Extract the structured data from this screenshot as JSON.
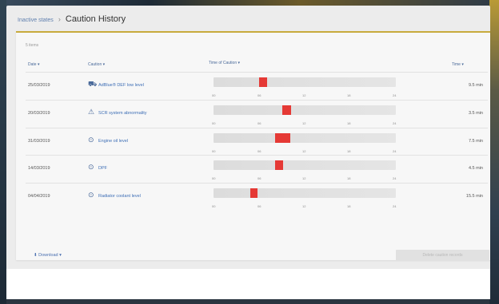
{
  "breadcrumb": {
    "parent": "Inactive states",
    "separator": "›",
    "current": "Caution History"
  },
  "card": {
    "items_count": "5 items",
    "headers": {
      "date": "Date ▾",
      "caution": "Caution ▾",
      "time_of_caution": "Time of Caution ▾",
      "time": "Time ▾"
    }
  },
  "timeline": {
    "ticks": [
      "00",
      "06",
      "12",
      "18",
      "24"
    ]
  },
  "rows": [
    {
      "date": "25/03/2019",
      "icon": "car-icon",
      "glyph": "⛟",
      "caution": "AdBlue® DEF low level",
      "start_fraction": 0.248,
      "width_fraction": 0.045,
      "duration": "9.5 min"
    },
    {
      "date": "20/03/2019",
      "icon": "engine-warning-icon",
      "glyph": "⚠",
      "caution": "SCR system abnormality",
      "start_fraction": 0.376,
      "width_fraction": 0.048,
      "duration": "3.5 min"
    },
    {
      "date": "31/03/2019",
      "icon": "oil-icon",
      "glyph": "⊙",
      "caution": "Engine oil level",
      "start_fraction": 0.338,
      "width_fraction": 0.083,
      "duration": "7.5 min"
    },
    {
      "date": "14/03/2019",
      "icon": "dpf-icon",
      "glyph": "⊙",
      "caution": "DPF",
      "start_fraction": 0.338,
      "width_fraction": 0.043,
      "duration": "4.5 min"
    },
    {
      "date": "04/04/2019",
      "icon": "coolant-icon",
      "glyph": "⊙",
      "caution": "Radiator coolant level",
      "start_fraction": 0.201,
      "width_fraction": 0.041,
      "duration": "15.5 min"
    }
  ],
  "footer": {
    "download_label": "⬇ Download ▾",
    "action_button_label": "Delete caution records"
  }
}
